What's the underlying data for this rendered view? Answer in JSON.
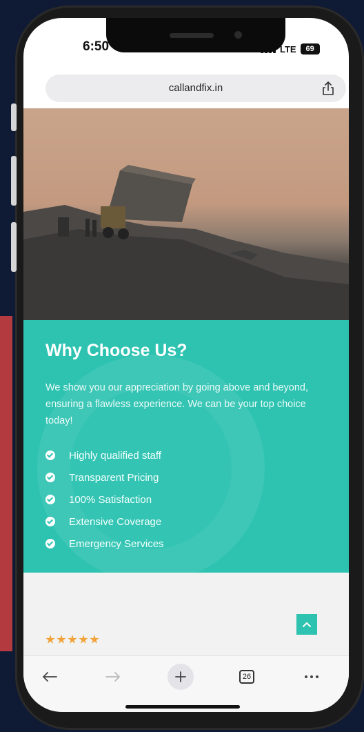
{
  "status_bar": {
    "time": "6:50",
    "network": "LTE",
    "battery": "69"
  },
  "browser": {
    "url": "callandfix.in",
    "tab_count": "26"
  },
  "why_section": {
    "heading": "Why Choose Us?",
    "paragraph": "We show you our appreciation by going above and beyond, ensuring a flawless experience. We can be your top choice today!",
    "features": [
      "Highly qualified staff",
      "Transparent Pricing",
      "100% Satisfaction",
      "Extensive Coverage",
      "Emergency Services"
    ]
  },
  "rating": {
    "stars": 5
  },
  "colors": {
    "teal": "#2ec3b1",
    "page_background": "#0f1a35",
    "accent_red": "#b33a3e",
    "star": "#f1a33a"
  },
  "icons": [
    "share-icon",
    "check-circle-icon",
    "chevron-up-icon",
    "back-arrow-icon",
    "forward-arrow-icon",
    "plus-icon",
    "tabs-icon",
    "more-icon"
  ]
}
